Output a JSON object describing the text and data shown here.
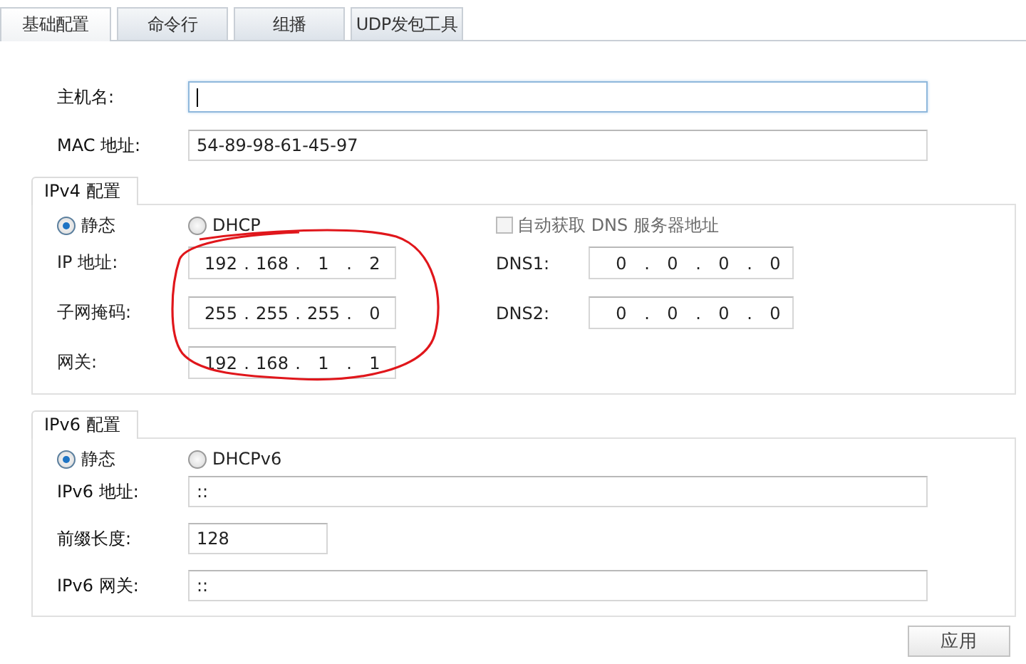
{
  "tabs": [
    {
      "label": "基础配置",
      "selected": true
    },
    {
      "label": "命令行",
      "selected": false
    },
    {
      "label": "组播",
      "selected": false
    },
    {
      "label": "UDP发包工具",
      "selected": false
    }
  ],
  "hostname": {
    "label": "主机名:",
    "focused": true
  },
  "mac": {
    "label": "MAC 地址:",
    "value": "54-89-98-61-45-97"
  },
  "ipv4": {
    "title": "IPv4 配置",
    "modes": [
      {
        "label": "静态",
        "selected": true
      },
      {
        "label": "DHCP",
        "selected": false
      }
    ],
    "auto_dns": {
      "label": "自动获取 DNS 服务器地址",
      "checked": false,
      "disabled": true
    },
    "fields": [
      {
        "label": "IP 地址:",
        "octets": [
          "192",
          "168",
          "1",
          "2"
        ]
      },
      {
        "label": "子网掩码:",
        "octets": [
          "255",
          "255",
          "255",
          "0"
        ]
      },
      {
        "label": "网关:",
        "octets": [
          "192",
          "168",
          "1",
          "1"
        ]
      }
    ],
    "dns": [
      {
        "label": "DNS1:",
        "octets": [
          "0",
          "0",
          "0",
          "0"
        ]
      },
      {
        "label": "DNS2:",
        "octets": [
          "0",
          "0",
          "0",
          "0"
        ]
      }
    ],
    "separator": "."
  },
  "ipv6": {
    "title": "IPv6 配置",
    "modes": [
      {
        "label": "静态",
        "selected": true
      },
      {
        "label": "DHCPv6",
        "selected": false
      }
    ],
    "fields": [
      {
        "label": "IPv6 地址:",
        "value": "::",
        "kind": "wide"
      },
      {
        "label": "前缀长度:",
        "value": "128",
        "kind": "short"
      },
      {
        "label": "IPv6 网关:",
        "value": "::",
        "kind": "wide"
      }
    ]
  },
  "apply_button": "应用"
}
